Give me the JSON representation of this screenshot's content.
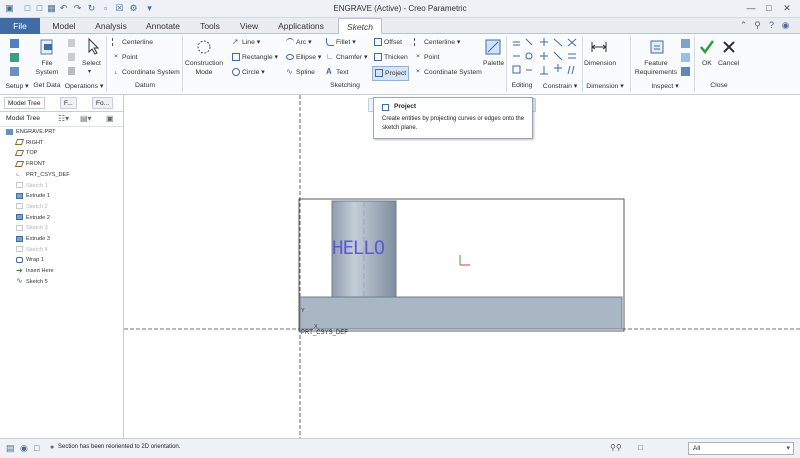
{
  "window": {
    "title": "ENGRAVE (Active) - Creo Parametric"
  },
  "tabs": [
    {
      "label": "File"
    },
    {
      "label": "Model"
    },
    {
      "label": "Analysis"
    },
    {
      "label": "Annotate"
    },
    {
      "label": "Tools"
    },
    {
      "label": "View"
    },
    {
      "label": "Applications"
    },
    {
      "label": "Sketch"
    }
  ],
  "ribbon": {
    "setup": {
      "file_system": "File\nSystem",
      "group_label": "Setup ▾"
    },
    "get_data": {
      "label": "Get Data"
    },
    "operations": {
      "select": "Select",
      "group_label": "Operations ▾"
    },
    "datum": {
      "centerline": "Centerline",
      "point": "Point",
      "coordinate_system": "Coordinate System",
      "group_label": "Datum"
    },
    "sketching": {
      "construction_mode": "Construction\nMode",
      "line": "Line ▾",
      "rectangle": "Rectangle ▾",
      "circle": "Circle ▾",
      "arc": "Arc ▾",
      "ellipse": "Ellipse ▾",
      "spline": "Spline",
      "fillet": "Fillet ▾",
      "chamfer": "Chamfer ▾",
      "text": "Text",
      "offset": "Offset",
      "thicken": "Thicken",
      "project": "Project",
      "centerline": "Centerline ▾",
      "point": "Point",
      "coordinate_system": "Coordinate System",
      "palette": "Palette",
      "group_label": "Sketching"
    },
    "editing": {
      "group_label": "Editing"
    },
    "constrain": {
      "group_label": "Constrain ▾"
    },
    "dimension": {
      "label": "Dimension",
      "group_label": "Dimension ▾"
    },
    "inspect": {
      "feature_requirements": "Feature\nRequirements",
      "group_label": "Inspect ▾"
    },
    "close": {
      "ok": "OK",
      "cancel": "Cancel",
      "group_label": "Close"
    }
  },
  "left_panel": {
    "tabs": [
      {
        "label": "Model Tree"
      },
      {
        "label": "F..."
      },
      {
        "label": "Fo..."
      }
    ],
    "header": "Model Tree",
    "tree": [
      {
        "label": "ENGRAVE.PRT",
        "icon": "part-icon",
        "dim": false
      },
      {
        "label": "RIGHT",
        "icon": "datum-plane-icon",
        "dim": false
      },
      {
        "label": "TOP",
        "icon": "datum-plane-icon",
        "dim": false
      },
      {
        "label": "FRONT",
        "icon": "datum-plane-icon",
        "dim": false
      },
      {
        "label": "PRT_CSYS_DEF",
        "icon": "csys-icon",
        "dim": false
      },
      {
        "label": "Sketch 1",
        "icon": "sketch-icon",
        "dim": true
      },
      {
        "label": "Extrude 1",
        "icon": "extrude-icon",
        "dim": false
      },
      {
        "label": "Sketch 2",
        "icon": "sketch-icon",
        "dim": true
      },
      {
        "label": "Extrude 2",
        "icon": "extrude-icon",
        "dim": false
      },
      {
        "label": "Sketch 3",
        "icon": "sketch-icon",
        "dim": true
      },
      {
        "label": "Extrude 3",
        "icon": "extrude-icon",
        "dim": false
      },
      {
        "label": "Sketch 4",
        "icon": "sketch-icon",
        "dim": true
      },
      {
        "label": "Wrap 1",
        "icon": "wrap-icon",
        "dim": false
      },
      {
        "label": "Insert Here",
        "icon": "insert-arrow-icon",
        "dim": false
      },
      {
        "label": "Sketch 5",
        "icon": "sketch-active-icon",
        "dim": false
      }
    ]
  },
  "tooltip": {
    "title": "Project",
    "body": "Create entities by projecting curves or edges onto the sketch plane."
  },
  "graphics": {
    "engraved_text": "HELLO",
    "csys_label": "PRT_CSYS_DEF",
    "axis_y_label": "Y",
    "axis_x_label": "X"
  },
  "status_bar": {
    "message": "Section has been reoriented to 2D orientation.",
    "filter_value": "All"
  },
  "colors": {
    "accent": "#3f6ba6",
    "part_fill": "#a9b6c4",
    "engraved_text": "#5b5bd6"
  }
}
